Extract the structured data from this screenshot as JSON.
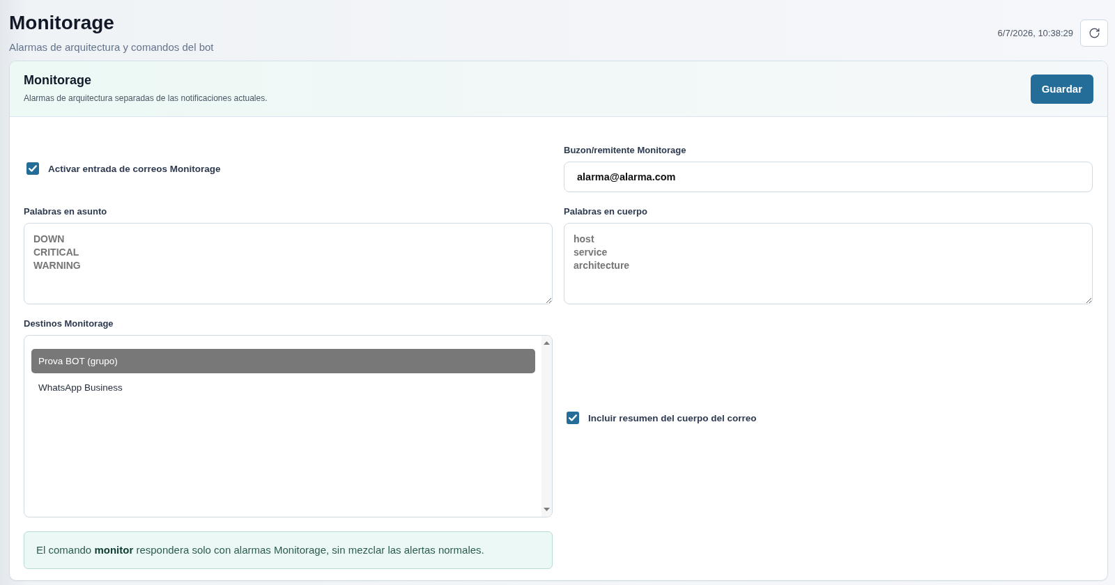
{
  "page": {
    "title": "Monitorage",
    "subtitle": "Alarmas de arquitectura y comandos del bot",
    "timestamp": "6/7/2026, 10:38:29"
  },
  "card": {
    "title": "Monitorage",
    "description": "Alarmas de arquitectura separadas de las notificaciones actuales.",
    "save_button": "Guardar"
  },
  "fields": [
    {
      "kind": "checkbox",
      "label": "Activar entrada de correos Monitorage",
      "checked": true
    },
    {
      "kind": "input",
      "label": "Buzon/remitente Monitorage",
      "value": "alarma@alarma.com"
    },
    {
      "kind": "textarea",
      "label": "Palabras en asunto",
      "placeholder": "DOWN\nCRITICAL\nWARNING"
    },
    {
      "kind": "textarea",
      "label": "Palabras en cuerpo",
      "placeholder": "host\nservice\narchitecture"
    },
    {
      "kind": "listbox",
      "label": "Destinos Monitorage",
      "options": [
        {
          "label": "Prova BOT (grupo)",
          "selected": true
        },
        {
          "label": "WhatsApp Business",
          "selected": false
        }
      ]
    },
    {
      "kind": "checkbox",
      "label": "Incluir resumen del cuerpo del correo",
      "checked": true
    },
    {
      "kind": "note",
      "text": "El comando **monitor** respondera solo con alarmas Monitorage, sin mezclar las alertas normales."
    }
  ]
}
